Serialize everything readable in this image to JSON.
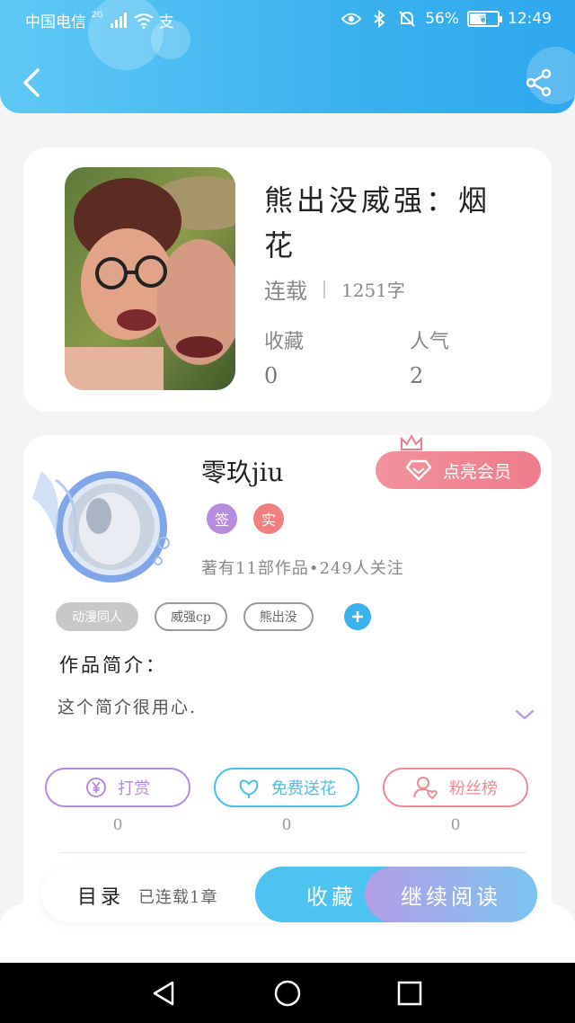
{
  "status_bar": {
    "carrier": "中国电信",
    "network": "2G",
    "extra_glyph": "支",
    "battery": "56%",
    "battery_level": 0.56,
    "time": "12:49",
    "icons": [
      "signal-icon",
      "wifi-icon",
      "eye-icon",
      "bluetooth-icon",
      "mute-bell-icon",
      "battery-icon"
    ]
  },
  "header": {
    "back_icon": "chevron-left-icon",
    "share_icon": "share-icon",
    "accent": "#3ab2ee"
  },
  "book": {
    "title": "熊出没威强：烟花",
    "status": "连载",
    "word_count": "1251字",
    "stats": [
      {
        "label": "收藏",
        "value": "0"
      },
      {
        "label": "人气",
        "value": "2"
      }
    ]
  },
  "author": {
    "name": "零玖jiu",
    "vip_button": "点亮会员",
    "badges": [
      {
        "label": "签",
        "color": "#b78be0"
      },
      {
        "label": "实",
        "color": "#f08080"
      }
    ],
    "meta": "著有11部作品•249人关注",
    "tags": [
      "动漫同人",
      "威强cp",
      "熊出没"
    ],
    "intro_title": "作品简介：",
    "intro_text": "这个简介很用心."
  },
  "actions": [
    {
      "label": "打赏",
      "count": "0",
      "icon": "yen-icon",
      "color": "#b58be0"
    },
    {
      "label": "免费送花",
      "count": "0",
      "icon": "flower-icon",
      "color": "#47c0ea"
    },
    {
      "label": "粉丝榜",
      "count": "0",
      "icon": "user-heart-icon",
      "color": "#ef8a92"
    }
  ],
  "bottom_bar": {
    "toc_label": "目录",
    "toc_count": "已连载1章",
    "collect_label": "收藏",
    "read_label": "继续阅读"
  }
}
